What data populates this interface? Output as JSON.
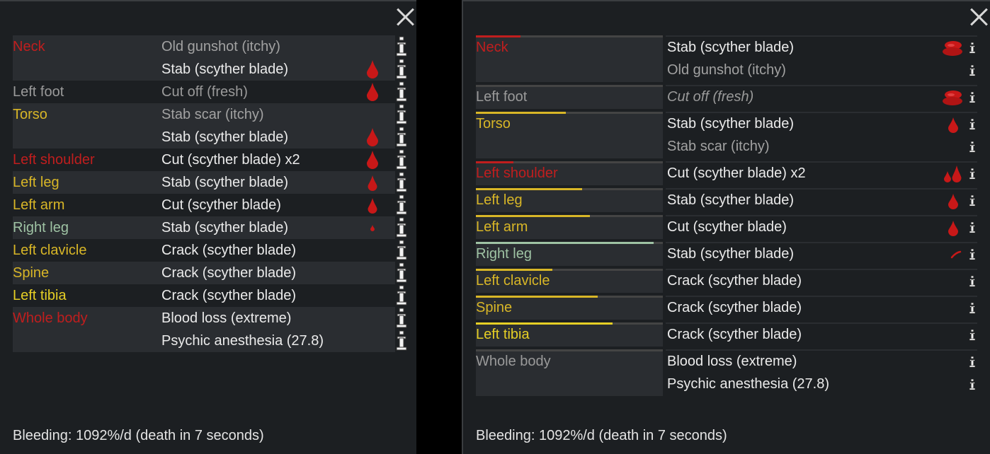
{
  "left": {
    "footer": "Bleeding: 1092%/d (death in 7 seconds)",
    "rows": [
      {
        "part": "Neck",
        "part_color": "red",
        "injury": "Old gunshot (itchy)",
        "inj_color": "lightgray",
        "bleed": "none",
        "alt": true
      },
      {
        "part": "",
        "part_color": "red",
        "injury": "Stab (scyther blade)",
        "inj_color": "white",
        "bleed": "large",
        "alt": true
      },
      {
        "part": "Left foot",
        "part_color": "gray",
        "injury": "Cut off (fresh)",
        "inj_color": "gray",
        "bleed": "large",
        "alt": false
      },
      {
        "part": "Torso",
        "part_color": "yellow",
        "injury": "Stab scar (itchy)",
        "inj_color": "lightgray",
        "bleed": "none",
        "alt": true
      },
      {
        "part": "",
        "part_color": "yellow",
        "injury": "Stab (scyther blade)",
        "inj_color": "white",
        "bleed": "large",
        "alt": true
      },
      {
        "part": "Left shoulder",
        "part_color": "red",
        "injury": "Cut (scyther blade) x2",
        "inj_color": "white",
        "bleed": "large",
        "alt": false
      },
      {
        "part": "Left leg",
        "part_color": "yellow",
        "injury": "Stab (scyther blade)",
        "inj_color": "white",
        "bleed": "medium",
        "alt": true
      },
      {
        "part": "Left arm",
        "part_color": "yellow",
        "injury": "Cut (scyther blade)",
        "inj_color": "white",
        "bleed": "medium",
        "alt": false
      },
      {
        "part": "Right leg",
        "part_color": "green",
        "injury": "Stab (scyther blade)",
        "inj_color": "white",
        "bleed": "tiny",
        "alt": true
      },
      {
        "part": "Left clavicle",
        "part_color": "yellow",
        "injury": "Crack (scyther blade)",
        "inj_color": "white",
        "bleed": "none",
        "alt": false
      },
      {
        "part": "Spine",
        "part_color": "yellow",
        "injury": "Crack (scyther blade)",
        "inj_color": "white",
        "bleed": "none",
        "alt": true
      },
      {
        "part": "Left tibia",
        "part_color": "tibia",
        "injury": "Crack (scyther blade)",
        "inj_color": "white",
        "bleed": "none",
        "alt": false
      },
      {
        "part": "Whole body",
        "part_color": "red",
        "injury": "Blood loss (extreme)",
        "inj_color": "white",
        "bleed": "none",
        "alt": true
      },
      {
        "part": "",
        "part_color": "red",
        "injury": "Psychic anesthesia (27.8)",
        "inj_color": "white",
        "bleed": "none",
        "alt": true
      }
    ]
  },
  "right": {
    "footer": "Bleeding: 1092%/d (death in 7 seconds)",
    "groups": [
      {
        "part": "Neck",
        "part_color": "red",
        "health": 0.24,
        "bar_color": "#c01e1e",
        "injuries": [
          {
            "text": "Stab (scyther blade)",
            "color": "white",
            "italic": false,
            "bleed": "pool"
          },
          {
            "text": "Old gunshot (itchy)",
            "color": "lightgray",
            "italic": false,
            "bleed": "none"
          }
        ]
      },
      {
        "part": "Left foot",
        "part_color": "gray",
        "health": 0.0,
        "bar_color": "#9a9a9a",
        "injuries": [
          {
            "text": "Cut off (fresh)",
            "color": "gray",
            "italic": true,
            "bleed": "pool"
          }
        ]
      },
      {
        "part": "Torso",
        "part_color": "yellow",
        "health": 0.48,
        "bar_color": "#d8b627",
        "injuries": [
          {
            "text": "Stab (scyther blade)",
            "color": "white",
            "italic": false,
            "bleed": "drop"
          },
          {
            "text": "Stab scar (itchy)",
            "color": "lightgray",
            "italic": false,
            "bleed": "none"
          }
        ]
      },
      {
        "part": "Left shoulder",
        "part_color": "red",
        "health": 0.2,
        "bar_color": "#c01e1e",
        "injuries": [
          {
            "text": "Cut (scyther blade) x2",
            "color": "white",
            "italic": false,
            "bleed": "double"
          }
        ]
      },
      {
        "part": "Left leg",
        "part_color": "yellow",
        "health": 0.57,
        "bar_color": "#d8b627",
        "injuries": [
          {
            "text": "Stab (scyther blade)",
            "color": "white",
            "italic": false,
            "bleed": "drop"
          }
        ]
      },
      {
        "part": "Left arm",
        "part_color": "yellow",
        "health": 0.61,
        "bar_color": "#d8b627",
        "injuries": [
          {
            "text": "Cut (scyther blade)",
            "color": "white",
            "italic": false,
            "bleed": "drop"
          }
        ]
      },
      {
        "part": "Right leg",
        "part_color": "green",
        "health": 0.95,
        "bar_color": "#9fc3a4",
        "injuries": [
          {
            "text": "Stab (scyther blade)",
            "color": "white",
            "italic": false,
            "bleed": "streak"
          }
        ]
      },
      {
        "part": "Left clavicle",
        "part_color": "yellow",
        "health": 0.41,
        "bar_color": "#d8b627",
        "injuries": [
          {
            "text": "Crack (scyther blade)",
            "color": "white",
            "italic": false,
            "bleed": "none"
          }
        ]
      },
      {
        "part": "Spine",
        "part_color": "yellow",
        "health": 0.65,
        "bar_color": "#d8b627",
        "injuries": [
          {
            "text": "Crack (scyther blade)",
            "color": "white",
            "italic": false,
            "bleed": "none"
          }
        ]
      },
      {
        "part": "Left tibia",
        "part_color": "tibia",
        "health": 0.73,
        "bar_color": "#e6cf25",
        "injuries": [
          {
            "text": "Crack (scyther blade)",
            "color": "white",
            "italic": false,
            "bleed": "none"
          }
        ]
      },
      {
        "part": "Whole body",
        "part_color": "gray",
        "health": 0.0,
        "bar_color": "#9a9a9a",
        "injuries": [
          {
            "text": "Blood loss (extreme)",
            "color": "white",
            "italic": false,
            "bleed": "none"
          },
          {
            "text": "Psychic anesthesia (27.8)",
            "color": "white",
            "italic": false,
            "bleed": "none"
          }
        ]
      }
    ]
  }
}
